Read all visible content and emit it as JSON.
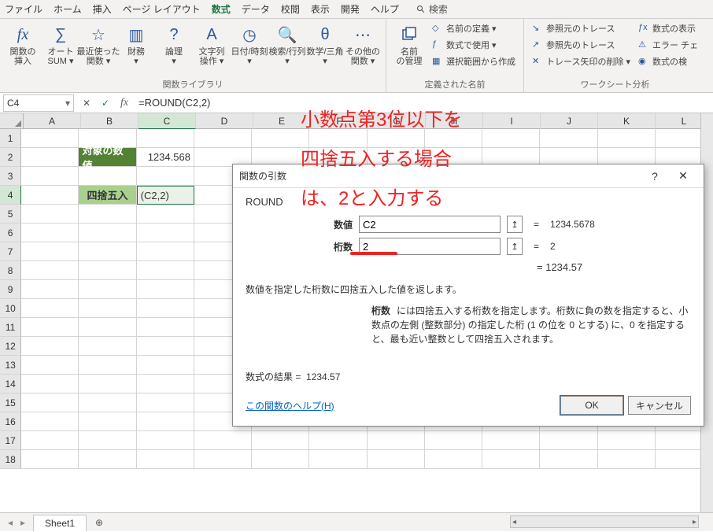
{
  "menubar": {
    "items": [
      "ファイル",
      "ホーム",
      "挿入",
      "ページ レイアウト",
      "数式",
      "データ",
      "校閲",
      "表示",
      "開発",
      "ヘルプ"
    ],
    "active": "数式",
    "search_placeholder": "検索"
  },
  "ribbon": {
    "groups": [
      {
        "label": "関数ライブラリ",
        "large": [
          {
            "name": "insert-function",
            "label": "関数の\n挿入",
            "icon": "fx"
          },
          {
            "name": "autosum",
            "label": "オート\nSUM ▾",
            "icon": "sigma"
          },
          {
            "name": "recent",
            "label": "最近使った\n関数 ▾",
            "icon": "star"
          },
          {
            "name": "financial",
            "label": "財務\n▾",
            "icon": "book"
          },
          {
            "name": "logical",
            "label": "論理\n▾",
            "icon": "question"
          },
          {
            "name": "text",
            "label": "文字列\n操作 ▾",
            "icon": "A"
          },
          {
            "name": "datetime",
            "label": "日付/時刻\n▾",
            "icon": "clock"
          },
          {
            "name": "lookup",
            "label": "検索/行列\n▾",
            "icon": "lookup"
          },
          {
            "name": "math",
            "label": "数学/三角\n▾",
            "icon": "theta"
          },
          {
            "name": "more",
            "label": "その他の\n関数 ▾",
            "icon": "dots"
          }
        ]
      },
      {
        "label": "定義された名前",
        "large": [
          {
            "name": "name-manager",
            "label": "名前\nの管理",
            "icon": "tag"
          }
        ],
        "small": [
          {
            "name": "define-name",
            "label": "名前の定義 ▾"
          },
          {
            "name": "use-in-formula",
            "label": "数式で使用 ▾"
          },
          {
            "name": "create-from-selection",
            "label": "選択範囲から作成"
          }
        ]
      },
      {
        "label": "ワークシート分析",
        "small": [
          {
            "name": "trace-precedents",
            "label": "参照元のトレース"
          },
          {
            "name": "trace-dependents",
            "label": "参照先のトレース"
          },
          {
            "name": "remove-arrows",
            "label": "トレース矢印の削除 ▾"
          }
        ],
        "small2": [
          {
            "name": "show-formulas",
            "label": "数式の表示"
          },
          {
            "name": "error-checking",
            "label": "エラー チェ"
          },
          {
            "name": "evaluate-formula",
            "label": "数式の検"
          }
        ]
      }
    ]
  },
  "formula_bar": {
    "name_box": "C4",
    "formula": "=ROUND(C2,2)"
  },
  "grid": {
    "columns": [
      "A",
      "B",
      "C",
      "D",
      "E",
      "F",
      "G",
      "H",
      "I",
      "J",
      "K",
      "L"
    ],
    "active_col": "C",
    "active_row": 4,
    "row_count": 18,
    "cells": {
      "B2": {
        "text": "対象の数値",
        "class": "val-header"
      },
      "C2": {
        "text": "1234.568",
        "class": "right"
      },
      "B4": {
        "text": "四捨五入",
        "class": "round-header"
      },
      "C4": {
        "text": "(C2,2)",
        "class": "editing"
      }
    }
  },
  "sheet": {
    "tabs": [
      "Sheet1"
    ]
  },
  "dialog": {
    "title": "関数の引数",
    "func": "ROUND",
    "args": [
      {
        "label": "数値",
        "value": "C2",
        "result": "1234.5678"
      },
      {
        "label": "桁数",
        "value": "2",
        "result": "2"
      }
    ],
    "preview": "1234.57",
    "desc": "数値を指定した桁数に四捨五入した値を返します。",
    "arg_desc_label": "桁数",
    "arg_desc_text": "には四捨五入する桁数を指定します。桁数に負の数を指定すると、小数点の左側 (整数部分) の指定した桁 (1 の位を 0 とする) に、0 を指定すると、最も近い整数として四捨五入されます。",
    "result_label": "数式の結果 =",
    "result_value": "1234.57",
    "help": "この関数のヘルプ(H)",
    "ok": "OK",
    "cancel": "キャンセル"
  },
  "annotation": {
    "line1": "小数点第3位以下を",
    "line2": "四捨五入する場合",
    "line3": "は、2と入力する"
  }
}
